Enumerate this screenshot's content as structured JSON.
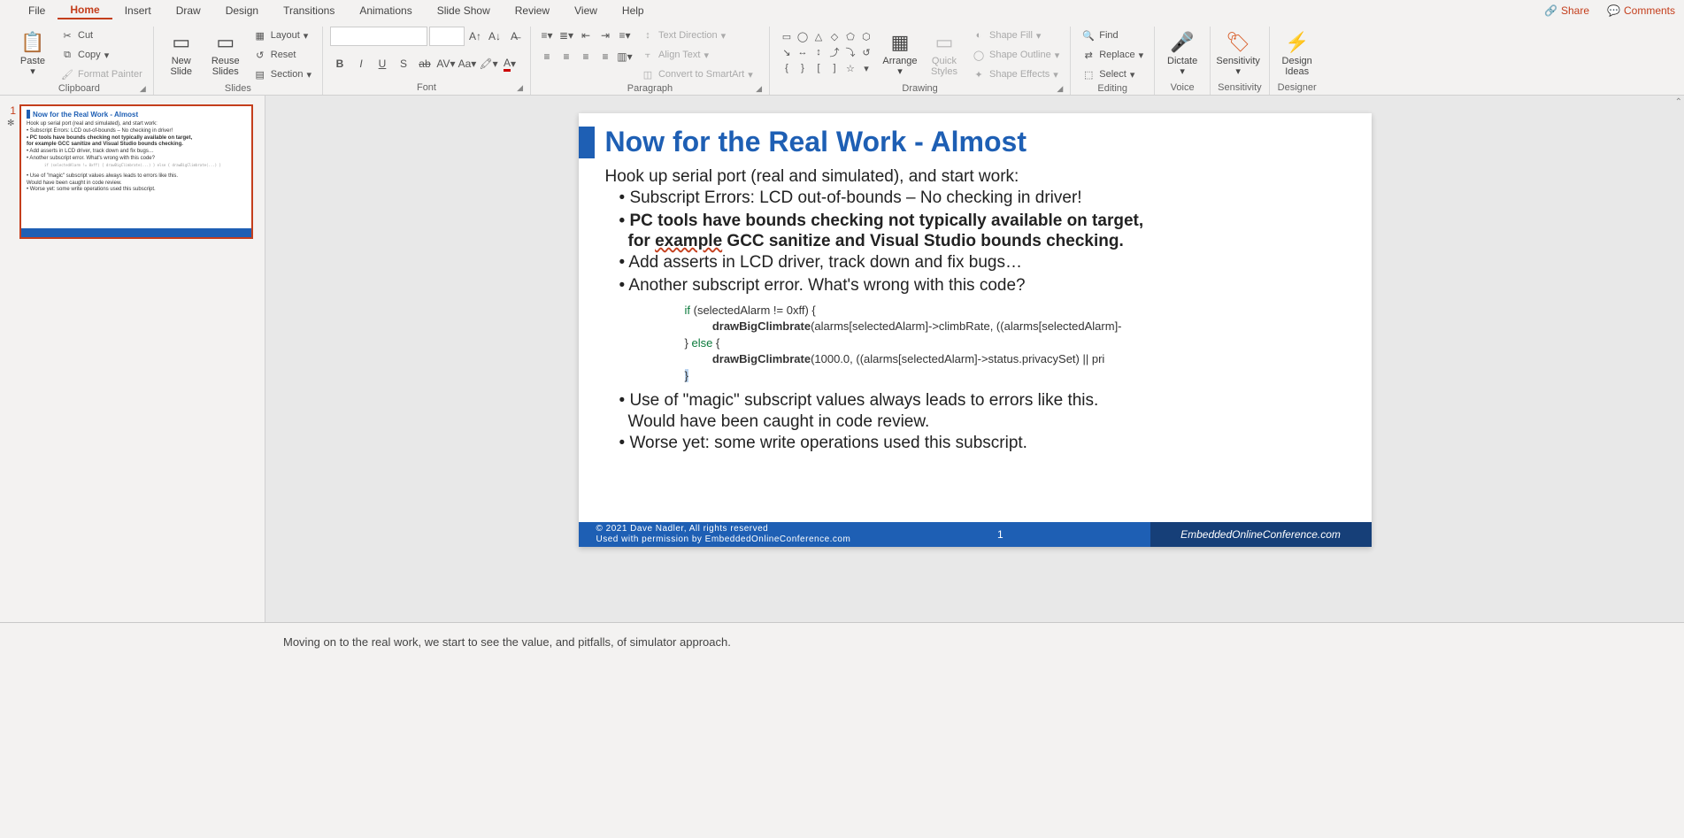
{
  "tabs": {
    "file": "File",
    "home": "Home",
    "insert": "Insert",
    "draw": "Draw",
    "design": "Design",
    "transitions": "Transitions",
    "animations": "Animations",
    "slideshow": "Slide Show",
    "review": "Review",
    "view": "View",
    "help": "Help"
  },
  "topright": {
    "share": "Share",
    "comments": "Comments"
  },
  "ribbon": {
    "clipboard": {
      "paste": "Paste",
      "cut": "Cut",
      "copy": "Copy",
      "format_painter": "Format Painter",
      "label": "Clipboard"
    },
    "slides": {
      "new_slide": "New\nSlide",
      "reuse": "Reuse\nSlides",
      "layout": "Layout",
      "reset": "Reset",
      "section": "Section",
      "label": "Slides"
    },
    "font": {
      "label": "Font"
    },
    "paragraph": {
      "text_direction": "Text Direction",
      "align_text": "Align Text",
      "smartart": "Convert to SmartArt",
      "label": "Paragraph"
    },
    "drawing": {
      "arrange": "Arrange",
      "quick_styles": "Quick\nStyles",
      "shape_fill": "Shape Fill",
      "shape_outline": "Shape Outline",
      "shape_effects": "Shape Effects",
      "label": "Drawing"
    },
    "editing": {
      "find": "Find",
      "replace": "Replace",
      "select": "Select",
      "label": "Editing"
    },
    "voice": {
      "dictate": "Dictate",
      "label": "Voice"
    },
    "sensitivity": {
      "btn": "Sensitivity",
      "label": "Sensitivity"
    },
    "designer": {
      "btn": "Design\nIdeas",
      "label": "Designer"
    }
  },
  "thumb": {
    "num": "1",
    "title": "Now for the Real Work - Almost",
    "l1": "Hook up serial port (real and simulated), and start work:",
    "l2": "• Subscript Errors: LCD out-of-bounds – No checking in driver!",
    "l3": "• PC tools have bounds checking not typically available on target,",
    "l3b": "  for example GCC sanitize and Visual Studio bounds checking.",
    "l4": "• Add asserts in LCD driver, track down and fix bugs…",
    "l5": "• Another subscript error. What's wrong with this code?",
    "l6": "• Use of \"magic\" subscript values always leads to errors like this.",
    "l6b": "  Would have been caught in code review.",
    "l7": "• Worse yet: some write operations used this subscript."
  },
  "slide": {
    "title": "Now for the Real Work - Almost",
    "intro": "Hook up serial port (real and simulated), and start work:",
    "b1": "Subscript Errors: LCD out-of-bounds – No checking in driver!",
    "b2a": "PC tools have bounds checking not typically available on target,",
    "b2b_pre": "for ",
    "b2b_ex": "example",
    "b2b_post": " GCC sanitize and Visual Studio bounds checking.",
    "b3": "Add asserts in LCD driver, track down and fix bugs…",
    "b4": "Another subscript error. What's wrong with this code?",
    "code": {
      "if": "if",
      "cond": " (selectedAlarm != 0xff) {",
      "fn": "drawBigClimbrate",
      "args1": "(alarms[selectedAlarm]->climbRate, ((alarms[selectedAlarm]-",
      "else_brace": "} ",
      "else": "else",
      "open": " {",
      "args2": "(1000.0, ((alarms[selectedAlarm]->status.privacySet) || pri",
      "close": "}"
    },
    "b5a": "Use of \"magic\" subscript values always leads to errors like this.",
    "b5b": "Would have been caught in code review.",
    "b6": "Worse yet: some write operations used this subscript.",
    "footer_left1": "© 2021 Dave Nadler, All rights reserved",
    "footer_left2": "Used with permission by EmbeddedOnlineConference.com",
    "footer_page": "1",
    "footer_right": "EmbeddedOnlineConference.com"
  },
  "notes": "Moving on to the real work, we start to see the value, and pitfalls, of simulator approach."
}
